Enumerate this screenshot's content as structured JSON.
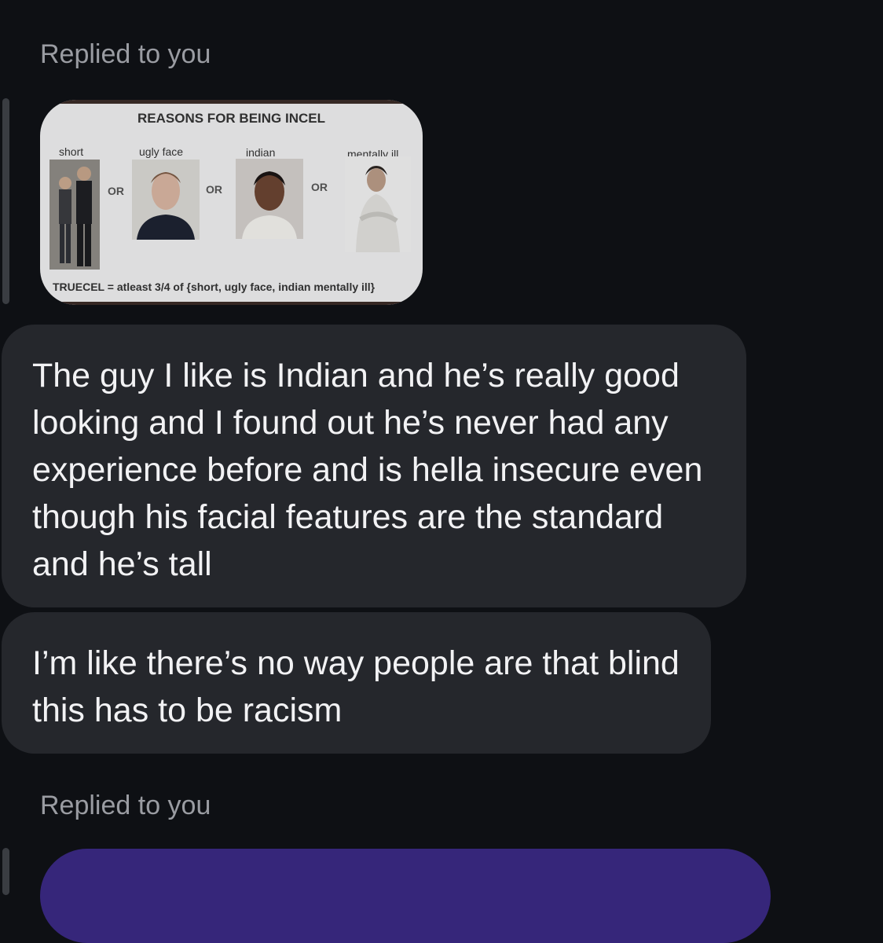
{
  "reply1": {
    "label": "Replied to you"
  },
  "meme": {
    "title": "REASONS FOR BEING INCEL",
    "captions": [
      "short",
      "ugly face",
      "indian",
      "mentally ill"
    ],
    "or_label": "OR",
    "footer": "TRUECEL = atleast 3/4 of {short, ugly face, indian mentally ill}"
  },
  "messages": [
    {
      "text": "The guy I like is Indian and he’s really good looking and I found out he’s never had any experience before and is hella insecure even though his facial features are the standard and he’s tall"
    },
    {
      "text": "I’m like there’s no way people are that blind this has to be racism"
    }
  ],
  "reply2": {
    "label": "Replied to you"
  },
  "colors": {
    "background": "#0e1014",
    "bubble": "#25272c",
    "accent_purple": "#36267a"
  }
}
